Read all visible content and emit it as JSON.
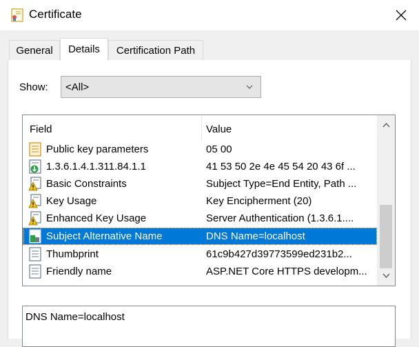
{
  "window": {
    "title": "Certificate"
  },
  "tabs": [
    {
      "label": "General",
      "active": false
    },
    {
      "label": "Details",
      "active": true
    },
    {
      "label": "Certification Path",
      "active": false
    }
  ],
  "show": {
    "label": "Show:",
    "value": "<All>"
  },
  "table": {
    "columns": [
      "Field",
      "Value"
    ],
    "rows": [
      {
        "icon": "document-icon",
        "field": "Public key parameters",
        "value": "05 00"
      },
      {
        "icon": "document-download-icon",
        "field": "1.3.6.1.4.1.311.84.1.1",
        "value": "41 53 50 2e 4e 45 54 20 43 6f ..."
      },
      {
        "icon": "warning-document-icon",
        "field": "Basic Constraints",
        "value": "Subject Type=End Entity, Path ..."
      },
      {
        "icon": "warning-document-icon",
        "field": "Key Usage",
        "value": "Key Encipherment (20)"
      },
      {
        "icon": "warning-document-icon",
        "field": "Enhanced Key Usage",
        "value": "Server Authentication (1.3.6.1...."
      },
      {
        "icon": "extension-document-icon",
        "field": "Subject Alternative Name",
        "value": "DNS Name=localhost",
        "selected": true
      },
      {
        "icon": "document-icon",
        "field": "Thumbprint",
        "value": "61c9b427d39773599ed231b2..."
      },
      {
        "icon": "document-icon",
        "field": "Friendly name",
        "value": "ASP.NET Core HTTPS developm..."
      }
    ]
  },
  "detail": {
    "text": "DNS Name=localhost"
  },
  "colors": {
    "selection": "#0078d7",
    "warning": "#f5c400"
  }
}
